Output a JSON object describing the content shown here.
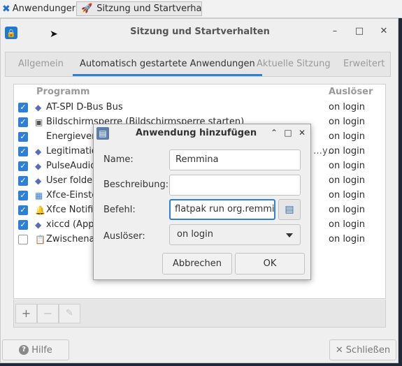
{
  "panel": {
    "apps_label": "Anwendungen",
    "apps_separator": "☰",
    "task_label": "Sitzung und Startverhalt..."
  },
  "window": {
    "title": "Sitzung und Startverhalten",
    "tabs": [
      "Allgemein",
      "Automatisch gestartete Anwendungen",
      "Aktuelle Sitzung",
      "Erweitert"
    ],
    "active_tab": "Automatisch gestartete Anwendungen",
    "columns": {
      "program": "Programm",
      "trigger": "Auslöser"
    },
    "rows": [
      {
        "name": "AT-SPI D-Bus Bus",
        "trigger": "on login",
        "checked": true,
        "icon": "diamond-icon"
      },
      {
        "name": "Bildschirmsperre (Bildschirmsperre starten)",
        "trigger": "on login",
        "checked": true,
        "icon": "screen-icon"
      },
      {
        "name": "Energieverw",
        "trigger": "on login",
        "checked": true,
        "icon": ""
      },
      {
        "name": "Legitimatio",
        "trigger": "on login",
        "checked": true,
        "icon": "diamond-icon"
      },
      {
        "name": "PulseAudio",
        "trigger": "on login",
        "checked": true,
        "icon": "diamond-icon"
      },
      {
        "name": "User folders",
        "trigger": "on login",
        "checked": true,
        "icon": "diamond-icon"
      },
      {
        "name": "Xfce-Einste",
        "trigger": "on login",
        "checked": true,
        "icon": "settings-icon"
      },
      {
        "name": "Xfce Notific",
        "trigger": "on login",
        "checked": true,
        "icon": "bell-icon"
      },
      {
        "name": "xiccd (Appli",
        "trigger": "on login",
        "checked": true,
        "icon": "diamond-icon"
      },
      {
        "name": "Zwischenab",
        "trigger": "on login",
        "checked": false,
        "icon": "clipboard-icon"
      }
    ],
    "truncated_suffix": "…y…",
    "toolbar": {
      "add": "+",
      "remove": "−",
      "edit": "✎"
    },
    "help_label": "Hilfe",
    "close_label": "Schließen"
  },
  "dialog": {
    "title": "Anwendung hinzufügen",
    "name_label": "Name:",
    "name_value": "Remmina",
    "description_label": "Beschreibung:",
    "description_value": "",
    "command_label": "Befehl:",
    "command_value": "flatpak run org.remmin",
    "trigger_label": "Auslöser:",
    "trigger_value": "on login",
    "cancel_label": "Abbrechen",
    "ok_label": "OK"
  },
  "colors": {
    "accent": "#2f7fd6",
    "desktop": "#1e2a38"
  }
}
